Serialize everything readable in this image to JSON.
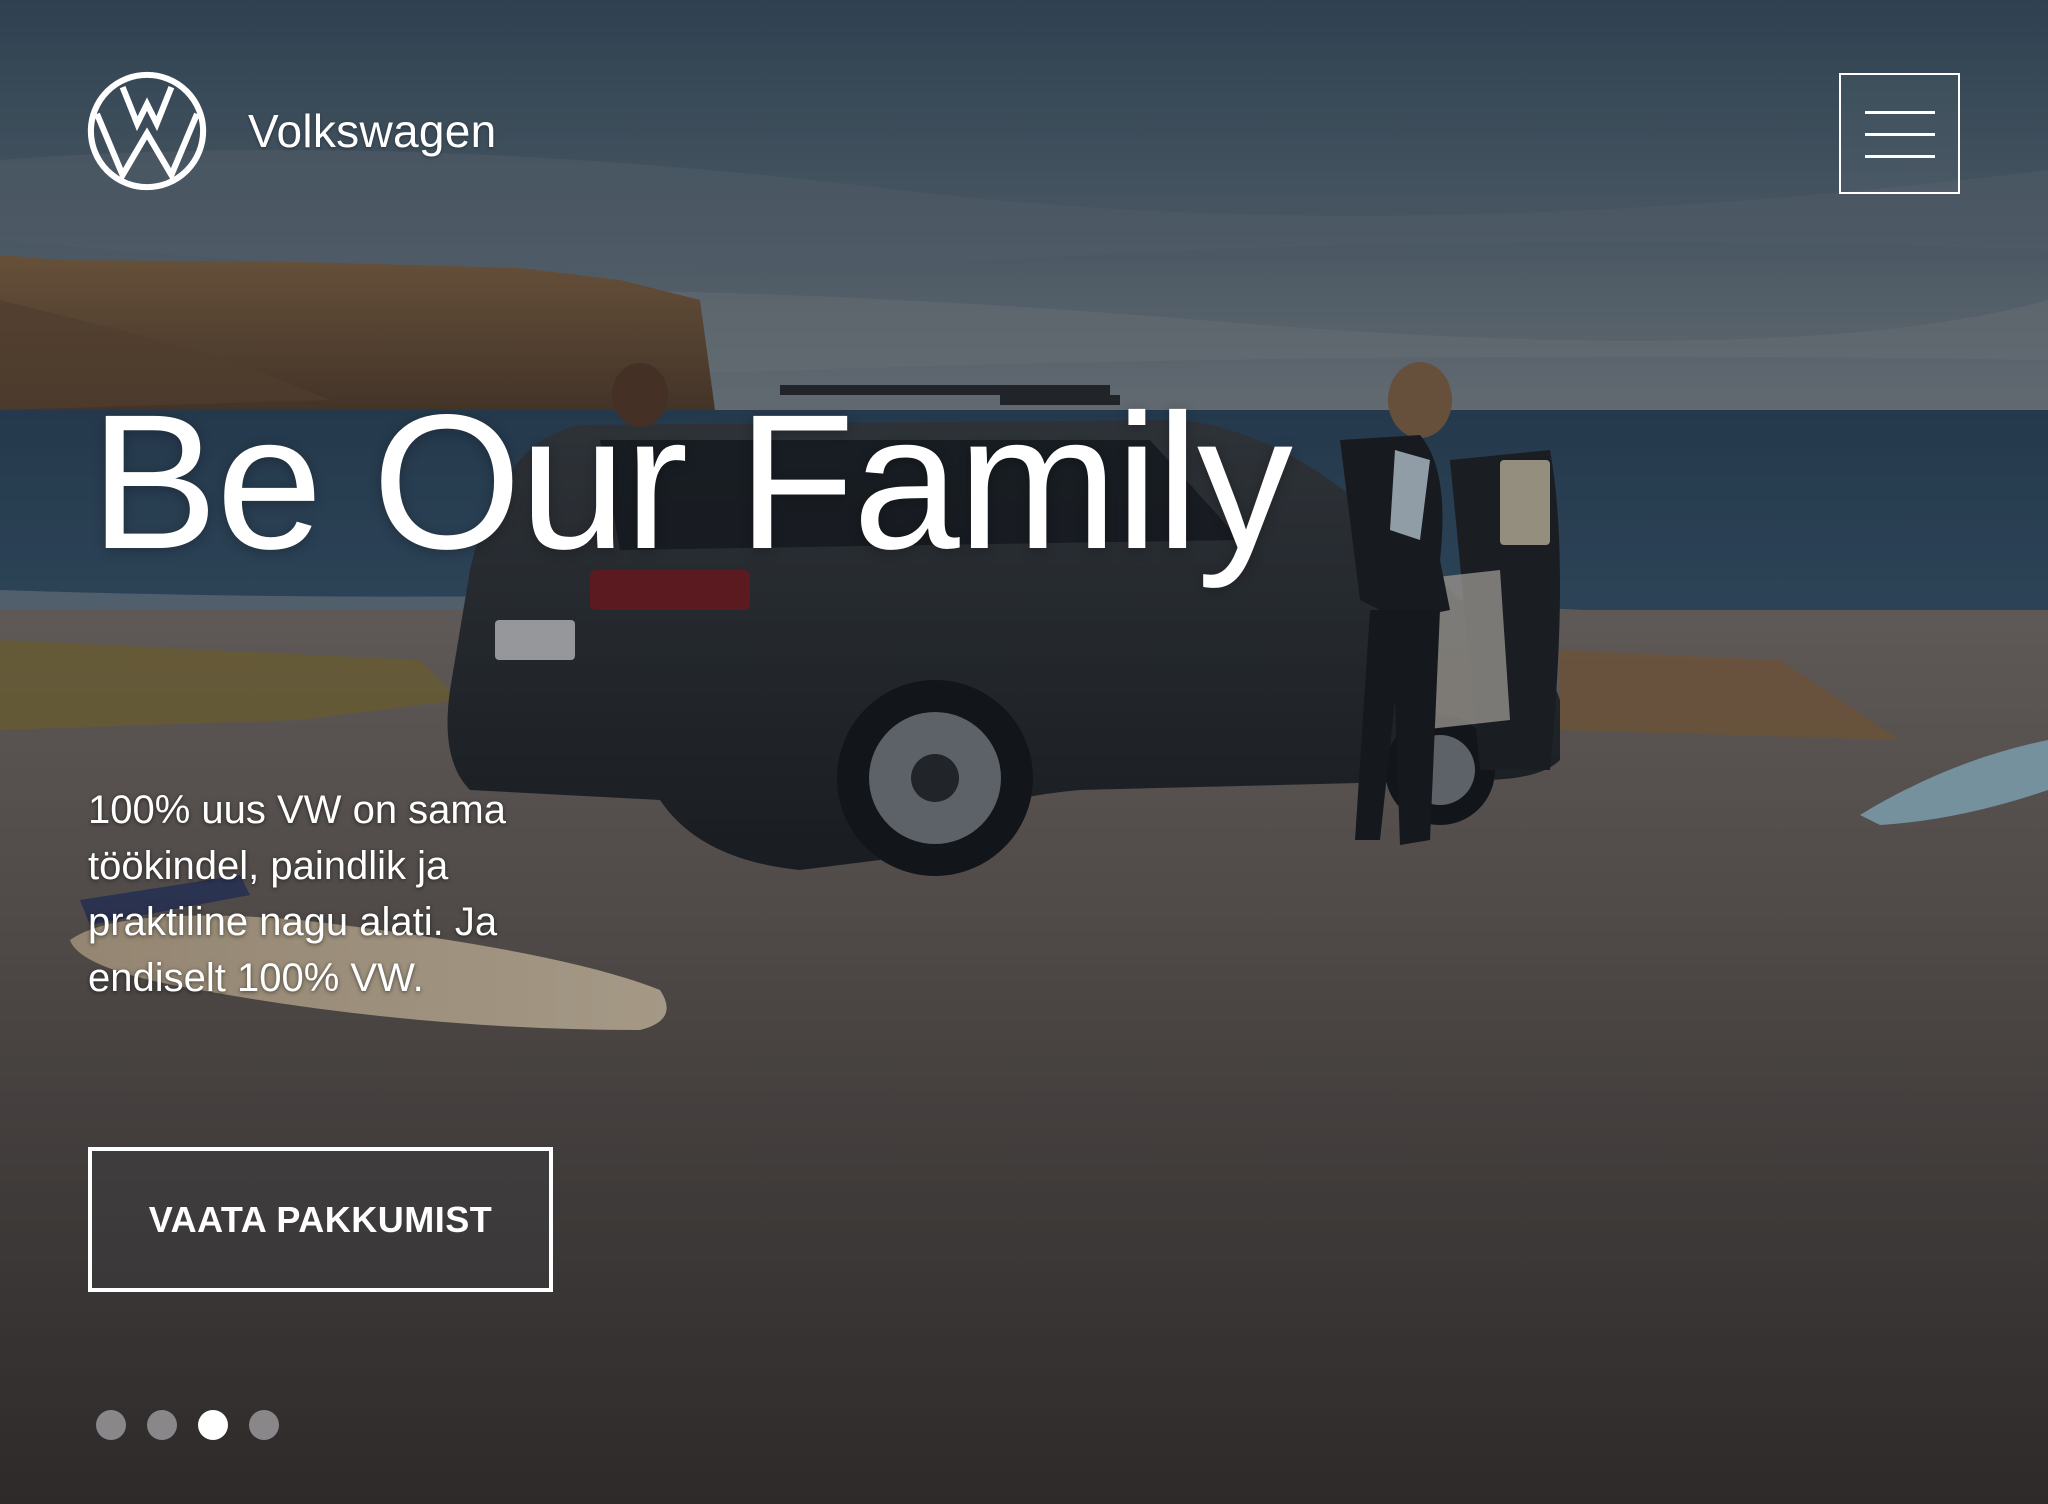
{
  "header": {
    "brand_name": "Volkswagen",
    "logo_icon": "vw-logo-icon",
    "menu_icon": "hamburger-menu-icon"
  },
  "hero": {
    "headline": "Be Our Family",
    "tagline": "100% uus VW on sama töökindel, paindlik ja praktiline nagu alati. Ja endiselt 100% VW.",
    "cta_label": "VAATA PAKKUMIST"
  },
  "carousel": {
    "slide_count": 4,
    "active_index": 2
  },
  "colors": {
    "text": "#ffffff",
    "dot_inactive": "#d2d2d6",
    "dot_active": "#ffffff"
  }
}
